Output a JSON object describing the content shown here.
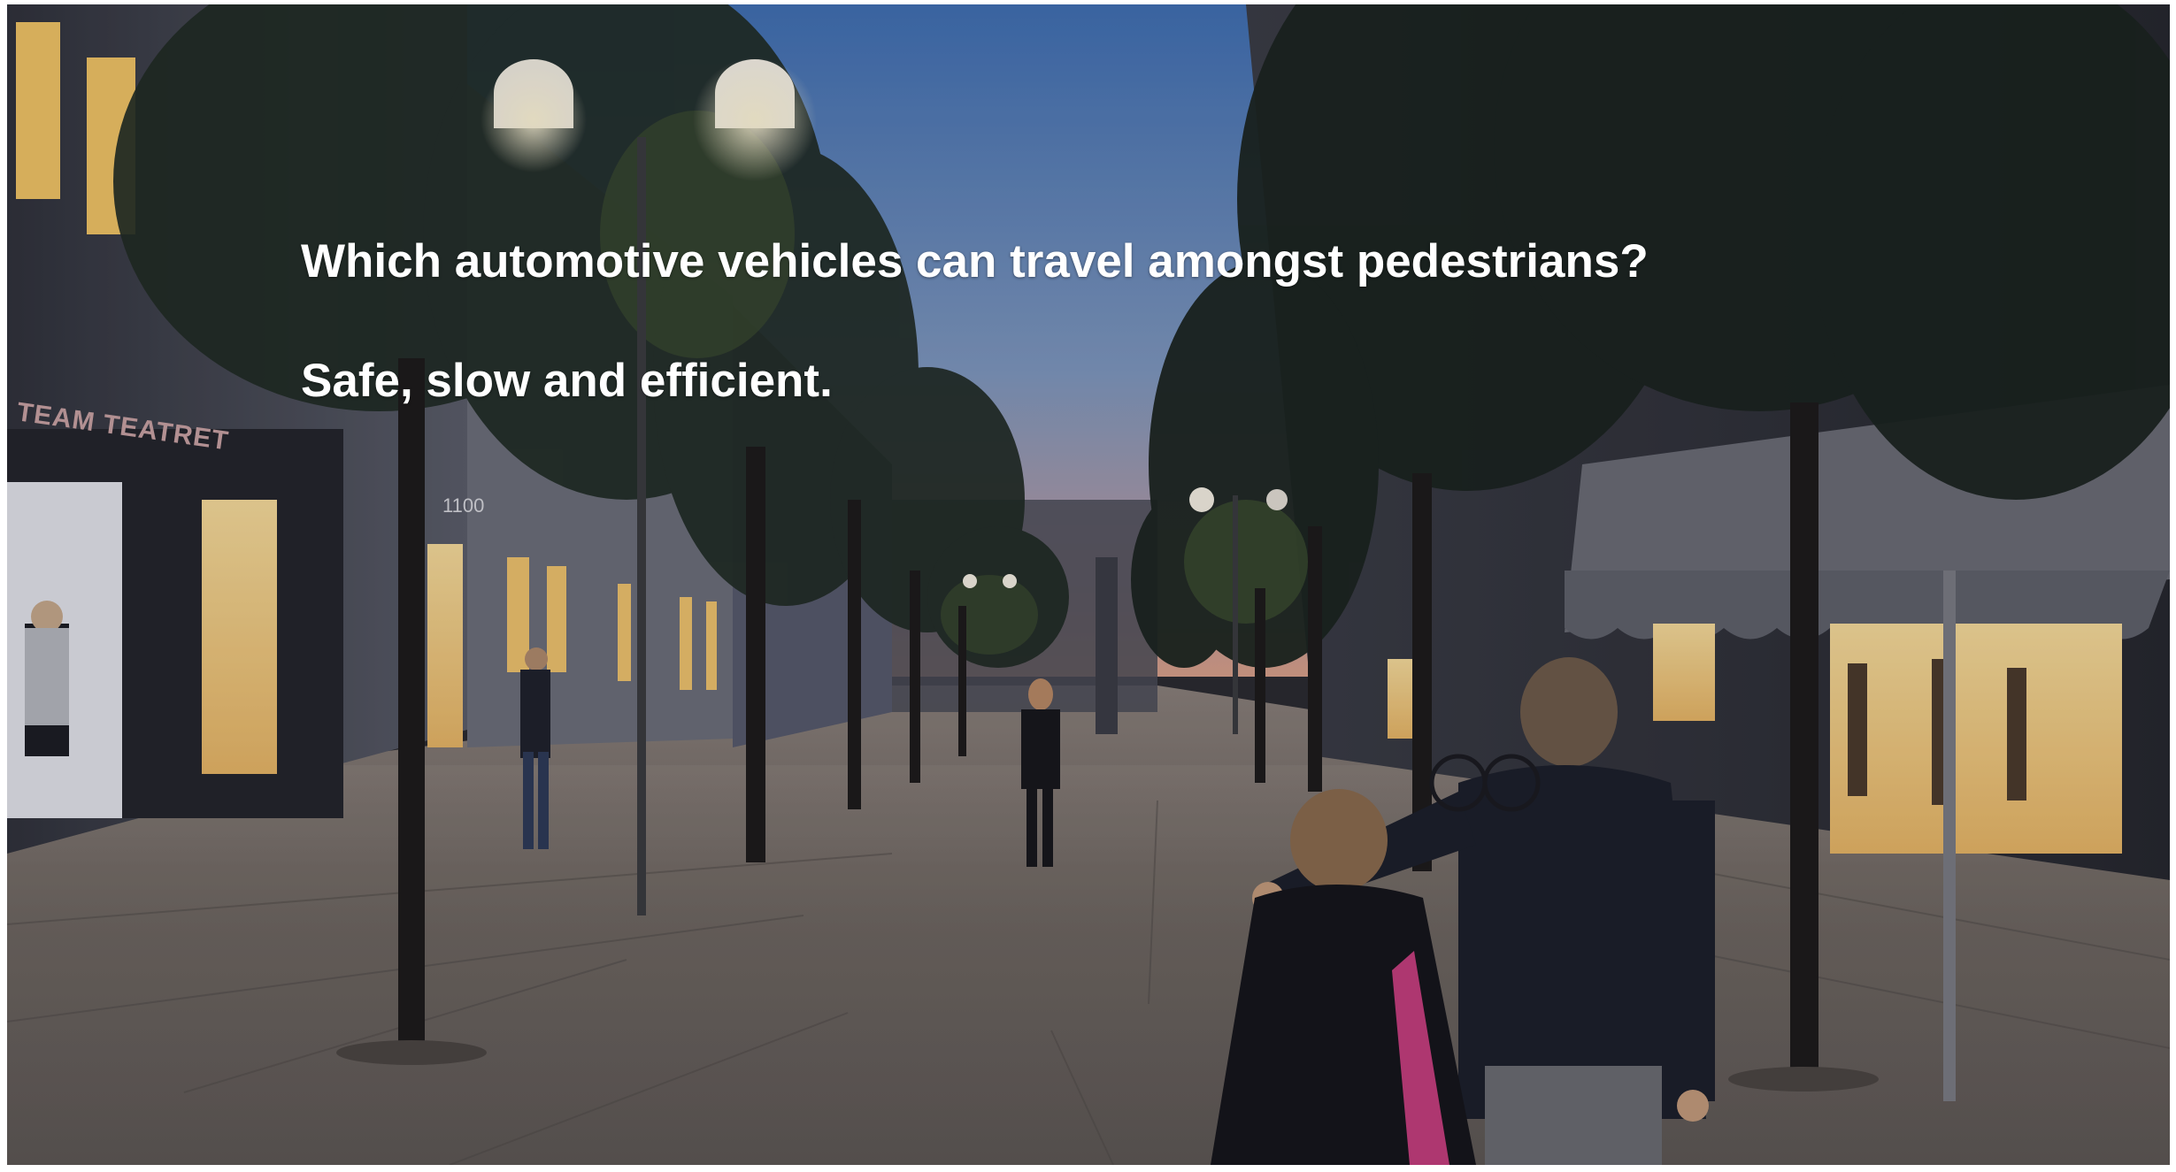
{
  "slide": {
    "question": "Which automotive vehicles can travel amongst pedestrians?",
    "tagline": "Safe, slow and efficient."
  },
  "scene": {
    "shop_sign": "TEAM TEATRET",
    "door_number": "1100"
  },
  "colors": {
    "sky_top": "#4a78b8",
    "sky_horizon": "#d7a38a",
    "pavement": "#6f6760",
    "window_glow": "#f4cf7c",
    "text": "#ffffff"
  }
}
